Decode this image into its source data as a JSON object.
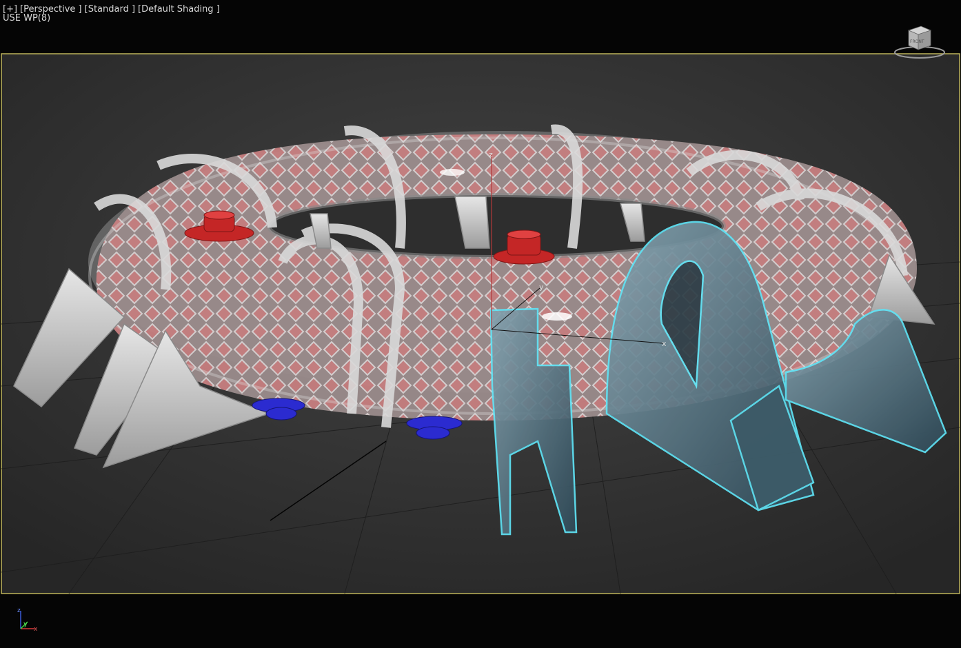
{
  "viewport": {
    "labels": [
      "[+]",
      "[Perspective ]",
      "[Standard ]",
      "[Default Shading ]"
    ],
    "workplane_label": "USE WP(8)",
    "viewcube_face_label": "FRONT",
    "axis_labels": {
      "x": "x",
      "y": "y",
      "z": "z"
    },
    "corner_axis": {
      "x": "x",
      "y": "y",
      "z": "z"
    }
  },
  "colors": {
    "background": "#050505",
    "grid_area": "#2f2f2f",
    "frame_border": "#bdb35a",
    "selection_outline": "#5fe3f5",
    "red_port": "#c42626",
    "blue_port": "#2b2bd0",
    "torus_pattern": "#b06a6a",
    "shell_gray": "#c8c8c8"
  }
}
